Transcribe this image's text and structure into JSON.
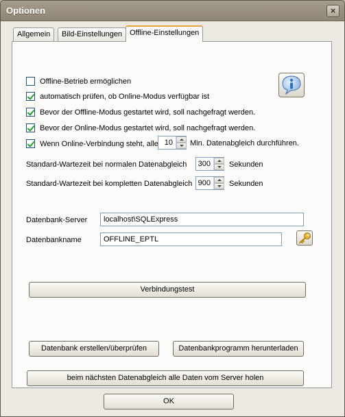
{
  "window": {
    "title": "Optionen",
    "close_glyph": "×"
  },
  "tabs": [
    {
      "label": "Allgemein"
    },
    {
      "label": "Bild-Einstellungen"
    },
    {
      "label": "Offline-Einstellungen",
      "active": true
    }
  ],
  "offline": {
    "cb_offline_betrieb": {
      "label": "Offline-Betrieb ermöglichen",
      "checked": false
    },
    "cb_auto_check": {
      "label": "automatisch prüfen, ob Online-Modus verfügbar ist",
      "checked": true
    },
    "cb_ask_offline": {
      "label": "Bevor der Offline-Modus gestartet wird, soll nachgefragt werden.",
      "checked": true
    },
    "cb_ask_online": {
      "label": "Bevor der Online-Modus gestartet wird, soll nachgefragt werden.",
      "checked": true
    },
    "cb_sync_interval": {
      "label": "Wenn Online-Verbindung steht, alle",
      "checked": true,
      "value": "10",
      "suffix": "Min. Datenabgleich durchführen."
    },
    "wait_normal": {
      "label": "Standard-Wartezeit bei normalen Datenabgleich",
      "value": "300",
      "unit": "Sekunden"
    },
    "wait_full": {
      "label": "Standard-Wartezeit bei kompletten Datenabgleich",
      "value": "900",
      "unit": "Sekunden"
    },
    "db_server": {
      "label": "Datenbank-Server",
      "value": "localhost\\SQLExpress"
    },
    "db_name": {
      "label": "Datenbankname",
      "value": "OFFLINE_EPTL"
    },
    "btn_test": "Verbindungstest",
    "btn_create": "Datenbank erstellen/überprüfen",
    "btn_download": "Datenbankprogramm herunterladen",
    "btn_fetch_all": "beim nächsten Datenabgleich alle Daten vom Server holen",
    "info_icon": "info-icon",
    "key_icon": "key-icon"
  },
  "footer": {
    "ok_label": "OK"
  },
  "colors": {
    "titlebar": "#9a917f",
    "tab_accent": "#e7a33c",
    "checkmark": "#21a121",
    "info_blue": "#2a6fc9",
    "key_gold": "#d9a520"
  }
}
